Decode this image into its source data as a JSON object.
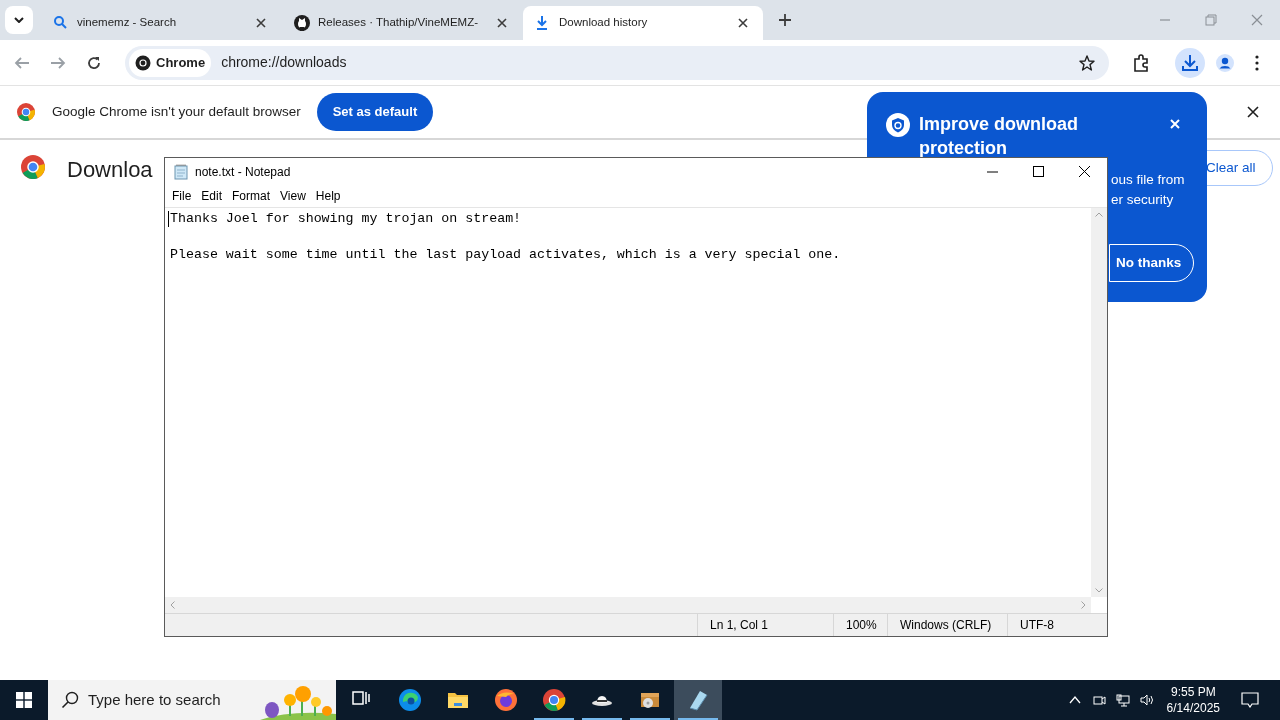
{
  "tabs": [
    {
      "title": "vinememz - Search",
      "selected": false
    },
    {
      "title": "Releases · Thathip/VineMEMZ-",
      "selected": false
    },
    {
      "title": "Download history",
      "selected": true
    }
  ],
  "address": {
    "chip": "Chrome",
    "url": "chrome://downloads"
  },
  "infobar": {
    "message": "Google Chrome isn't your default browser",
    "button": "Set as default"
  },
  "page": {
    "title": "Downloa",
    "clear_button": "Clear all"
  },
  "popup": {
    "title": "Improve download protection",
    "lines": [
      "ous file from",
      "er security"
    ],
    "button": "No thanks"
  },
  "notepad": {
    "title": "note.txt - Notepad",
    "menu": [
      "File",
      "Edit",
      "Format",
      "View",
      "Help"
    ],
    "text": "Thanks Joel for showing my trojan on stream!\n\nPlease wait some time until the last payload activates, which is a very special one.",
    "status": [
      "Ln 1, Col 1",
      "100%",
      "Windows (CRLF)",
      "UTF-8"
    ]
  },
  "taskbar": {
    "search_placeholder": "Type here to search",
    "apps": [
      {
        "kind": "taskview",
        "running": false,
        "active": false
      },
      {
        "kind": "edge",
        "running": false,
        "active": false
      },
      {
        "kind": "explorer",
        "running": false,
        "active": false
      },
      {
        "kind": "firefox",
        "running": false,
        "active": false
      },
      {
        "kind": "chrome",
        "running": true,
        "active": false
      },
      {
        "kind": "hat",
        "running": true,
        "active": false
      },
      {
        "kind": "installer",
        "running": true,
        "active": false
      },
      {
        "kind": "notepad",
        "running": true,
        "active": true
      }
    ],
    "time": "9:55 PM",
    "date": "6/14/2025"
  }
}
